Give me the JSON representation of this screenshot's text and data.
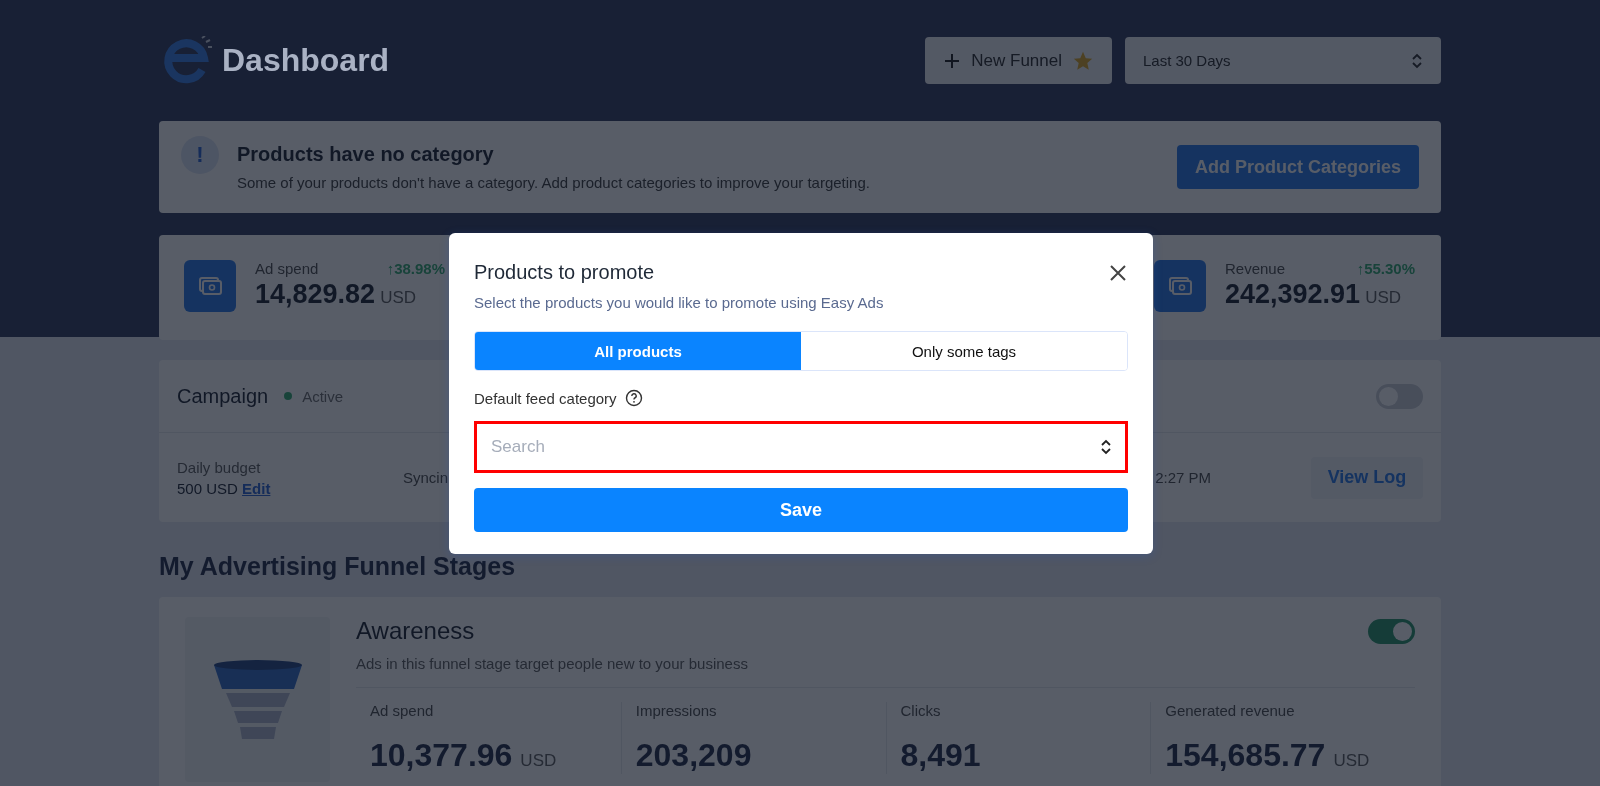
{
  "header": {
    "title": "Dashboard",
    "new_funnel_button": "New Funnel",
    "date_range": "Last 30 Days"
  },
  "alert": {
    "icon": "!",
    "title": "Products have no category",
    "message": "Some of your products don't have a category. Add product categories to improve your targeting.",
    "button": "Add Product Categories"
  },
  "stats": [
    {
      "label": "Ad spend",
      "change": "↑38.98%",
      "value": "14,829.82",
      "unit": "USD"
    },
    {
      "label": "Revenue",
      "change": "↑55.30%",
      "value": "242,392.91",
      "unit": "USD"
    }
  ],
  "campaign": {
    "title": "Campaign",
    "status": "Active",
    "on": false,
    "budget_label": "Daily budget",
    "budget_value": "500 USD",
    "edit_link": "Edit",
    "sync_text": "Syncin",
    "time_text": "2:27 PM",
    "view_log_button": "View Log"
  },
  "section_title": "My Advertising Funnel Stages",
  "stages": [
    {
      "title": "Awareness",
      "description": "Ads in this funnel stage target people new to your business",
      "on": true,
      "metrics": [
        {
          "label": "Ad spend",
          "value": "10,377.96",
          "unit": "USD"
        },
        {
          "label": "Impressions",
          "value": "203,209"
        },
        {
          "label": "Clicks",
          "value": "8,491"
        },
        {
          "label": "Generated revenue",
          "value": "154,685.77",
          "unit": "USD"
        }
      ]
    }
  ],
  "modal": {
    "title": "Products to promote",
    "subtitle": "Select the products you would like to promote using Easy Ads",
    "options": [
      {
        "label": "All products",
        "selected": true
      },
      {
        "label": "Only some tags",
        "selected": false
      }
    ],
    "field_label": "Default feed category",
    "search": {
      "placeholder": "Search",
      "highlighted": true
    },
    "save_button": "Save"
  }
}
